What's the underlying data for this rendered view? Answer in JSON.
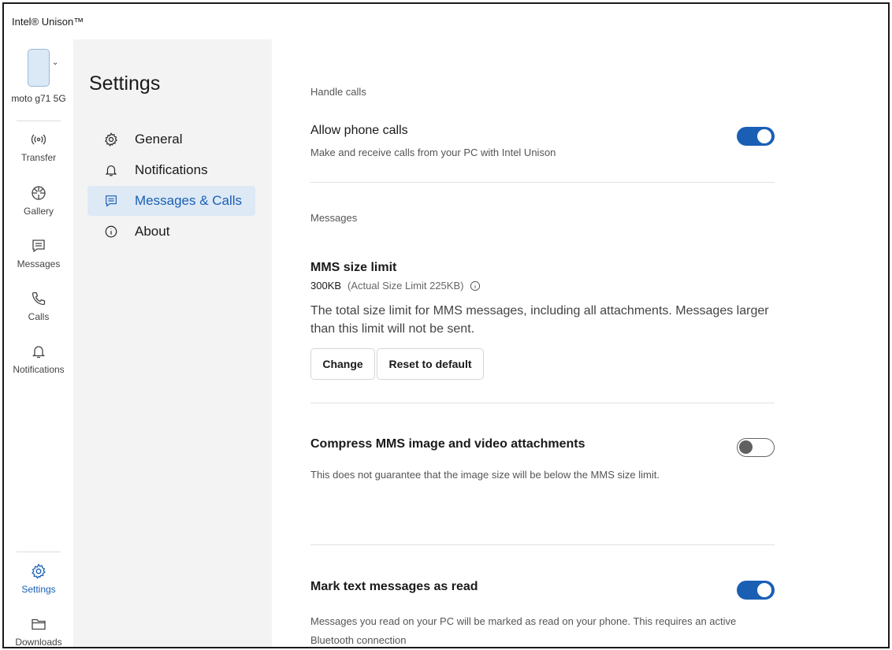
{
  "window": {
    "title": "Intel® Unison™"
  },
  "device": {
    "name": "moto g71 5G"
  },
  "rail": {
    "items": [
      {
        "label": "Transfer",
        "icon": "transfer-icon"
      },
      {
        "label": "Gallery",
        "icon": "gallery-icon"
      },
      {
        "label": "Messages",
        "icon": "messages-icon"
      },
      {
        "label": "Calls",
        "icon": "calls-icon"
      },
      {
        "label": "Notifications",
        "icon": "notifications-icon"
      }
    ],
    "bottom": [
      {
        "label": "Settings",
        "icon": "gear-icon",
        "active": true
      },
      {
        "label": "Downloads",
        "icon": "folder-icon"
      }
    ]
  },
  "settings_nav": {
    "title": "Settings",
    "items": [
      {
        "label": "General",
        "icon": "gear-icon"
      },
      {
        "label": "Notifications",
        "icon": "bell-icon"
      },
      {
        "label": "Messages & Calls",
        "icon": "message-icon",
        "active": true
      },
      {
        "label": "About",
        "icon": "info-icon"
      }
    ]
  },
  "content": {
    "handle_calls": {
      "heading": "Handle calls",
      "allow_calls": {
        "title": "Allow phone calls",
        "description": "Make and receive calls from your PC with Intel Unison",
        "enabled": true
      }
    },
    "messages": {
      "heading": "Messages",
      "mms": {
        "title": "MMS size limit",
        "size": "300KB",
        "actual": "(Actual Size Limit 225KB)",
        "description": "The total size limit for MMS messages, including all attachments. Messages larger than this limit will not be sent.",
        "change_label": "Change",
        "reset_label": "Reset to default"
      },
      "compress": {
        "title": "Compress MMS image and video attachments",
        "description": "This does not guarantee that the image size will be below the MMS size limit.",
        "enabled": false
      },
      "mark_read": {
        "title": "Mark text messages as read",
        "description": "Messages you read on your PC will be marked as read on your phone. This requires an active Bluetooth connection",
        "enabled": true
      }
    }
  },
  "colors": {
    "accent": "#1a5fb4",
    "nav_bg": "#f3f3f3",
    "active_bg": "#dde9f5"
  }
}
